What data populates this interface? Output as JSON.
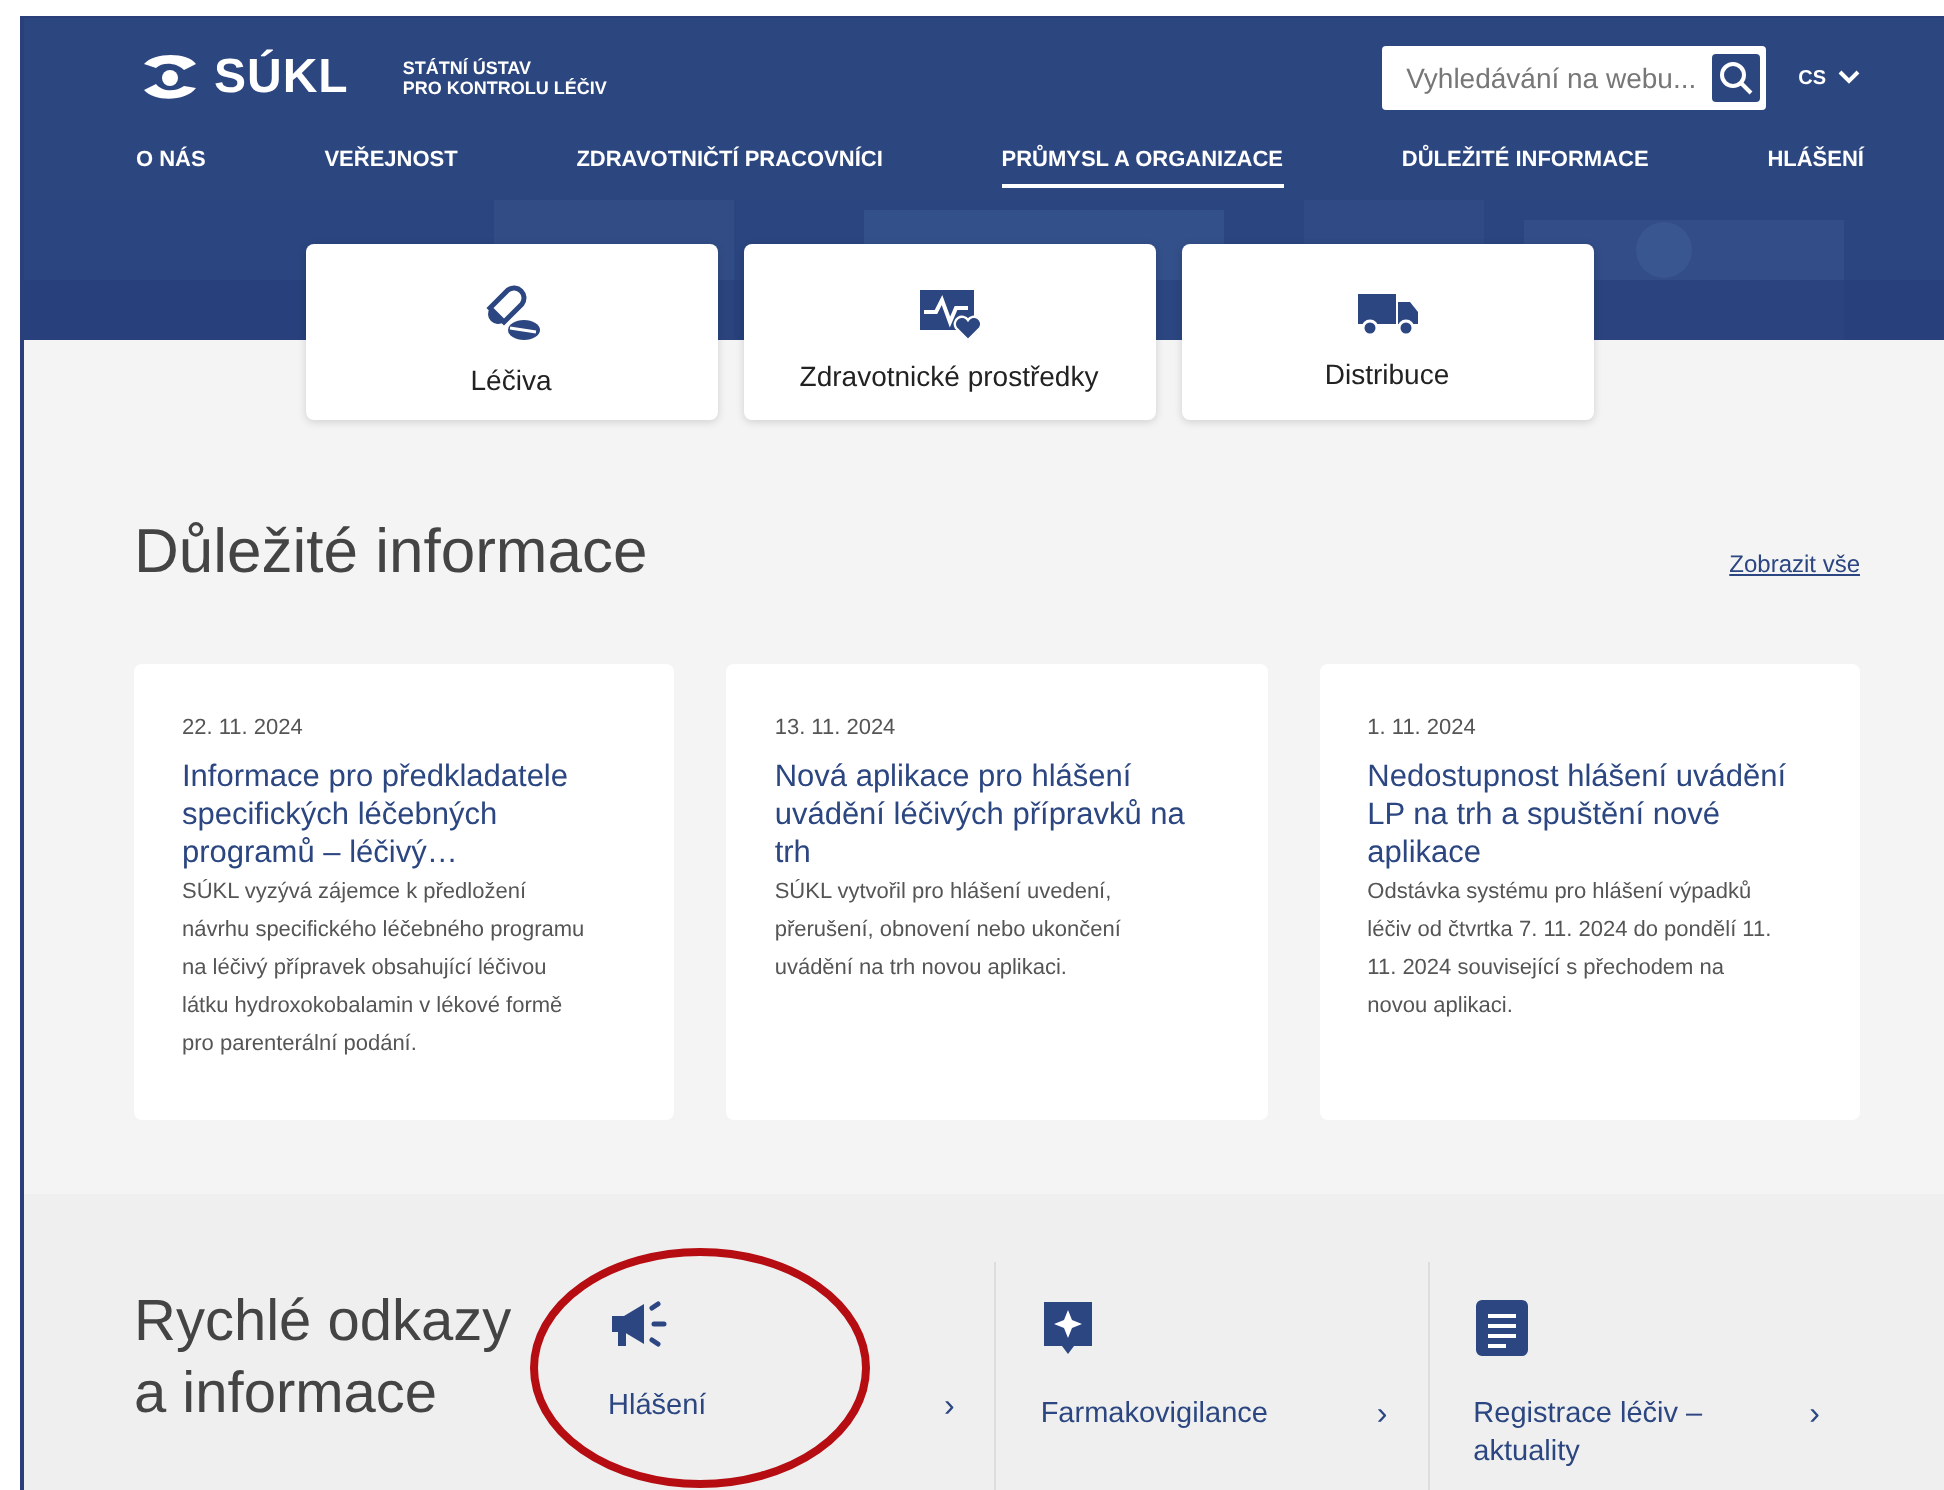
{
  "header": {
    "logo_text": "SÚKL",
    "logo_subtitle": [
      "STÁTNÍ ÚSTAV",
      "PRO KONTROLU LÉČIV"
    ],
    "search": {
      "placeholder": "Vyhledávání na webu..."
    },
    "language": "CS"
  },
  "nav": [
    {
      "label": "O NÁS",
      "selected": false
    },
    {
      "label": "VEŘEJNOST",
      "selected": false
    },
    {
      "label": "ZDRAVOTNIČTÍ PRACOVNÍCI",
      "selected": false
    },
    {
      "label": "PRŮMYSL A ORGANIZACE",
      "selected": true
    },
    {
      "label": "DŮLEŽITÉ INFORMACE",
      "selected": false
    },
    {
      "label": "HLÁŠENÍ",
      "selected": false
    }
  ],
  "categories": [
    {
      "label": "Léčiva",
      "kind": "pills"
    },
    {
      "label": "Zdravotnické prostředky",
      "kind": "monitor"
    },
    {
      "label": "Distribuce",
      "kind": "truck"
    }
  ],
  "important": {
    "title": "Důležité informace",
    "link": "Zobrazit vše",
    "articles": [
      {
        "date": "22. 11. 2024",
        "title": "Informace pro předkladatele specifických léčebných programů – léčivý…",
        "excerpt": "SÚKL vyzývá zájemce k předložení návrhu specifického léčebného programu na léčivý přípravek obsahující léčivou látku hydroxokobalamin v lékové formě pro parenterální podání."
      },
      {
        "date": "13. 11. 2024",
        "title": "Nová aplikace pro hlášení uvádění léčivých přípravků na trh",
        "excerpt": "SÚKL vytvořil pro hlášení uvedení, přerušení, obnovení nebo ukončení uvádění na trh novou aplikaci."
      },
      {
        "date": "1. 11. 2024",
        "title": "Nedostupnost hlášení uvádění LP na trh a spuštění nové aplikace",
        "excerpt": "Odstávka systému pro hlášení výpadků léčiv od čtvrtka 7. 11. 2024 do pondělí 11. 11. 2024 související s přechodem na novou aplikaci."
      }
    ]
  },
  "quick_links": {
    "title": "Rychlé odkazy a informace",
    "items": [
      {
        "label": "Hlášení",
        "kind": "megaphone",
        "chevron": "›",
        "circled": true
      },
      {
        "label": "Farmakovigilance",
        "kind": "star-bubble",
        "chevron": "›",
        "circled": false
      },
      {
        "label": "Registrace léčiv – aktuality",
        "kind": "document",
        "chevron": "›",
        "circled": false
      }
    ]
  }
}
